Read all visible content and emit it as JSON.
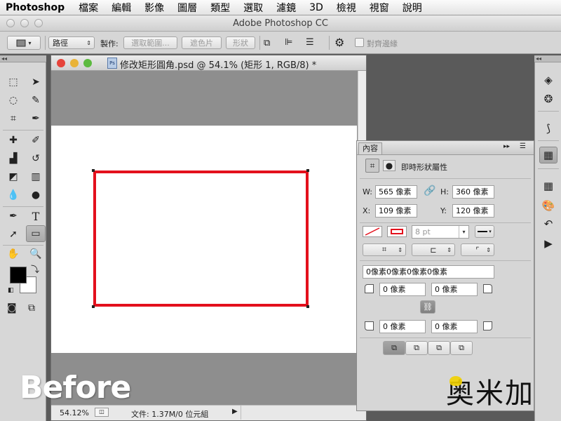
{
  "menubar": {
    "app_name": "Photoshop",
    "items": [
      "檔案",
      "編輯",
      "影像",
      "圖層",
      "類型",
      "選取",
      "濾鏡",
      "3D",
      "檢視",
      "視窗",
      "說明"
    ]
  },
  "window": {
    "title": "Adobe Photoshop CC"
  },
  "options_bar": {
    "mode_value": "路徑",
    "make_label": "製作:",
    "selection_button": "選取範圍...",
    "mask_button": "遮色片",
    "shape_button": "形狀",
    "align_edges_label": "對齊邊緣"
  },
  "document": {
    "title": "修改矩形圓角.psd @ 54.1% (矩形 1, RGB/8) *",
    "zoom": "54.12%",
    "file_info": "文件: 1.37M/0 位元組"
  },
  "properties_panel": {
    "tab_label": "內容",
    "shape_title": "即時形狀屬性",
    "w_label": "W:",
    "w_value": "565 像素",
    "h_label": "H:",
    "h_value": "360 像素",
    "x_label": "X:",
    "x_value": "109 像素",
    "y_label": "Y:",
    "y_value": "120 像素",
    "stroke_width": "8 pt",
    "corner_summary": "0像素0像素0像素0像素",
    "corner_top_left": "0 像素",
    "corner_top_right": "0 像素",
    "corner_bottom_left": "0 像素",
    "corner_bottom_right": "0 像素"
  },
  "overlay": {
    "before_label": "Before",
    "logo_text": "奥米加"
  },
  "colors": {
    "rectangle_stroke": "#e3101c",
    "foreground": "#000000",
    "background": "#ffffff"
  },
  "icons": {
    "toolbox": [
      "marquee-icon",
      "move-icon",
      "lasso-icon",
      "quick-select-icon",
      "crop-icon",
      "eyedropper-icon",
      "healing-icon",
      "brush-icon",
      "stamp-icon",
      "history-brush-icon",
      "eraser-icon",
      "gradient-icon",
      "blur-icon",
      "dodge-icon",
      "pen-icon",
      "type-icon",
      "path-select-icon",
      "rectangle-icon",
      "hand-icon",
      "zoom-icon"
    ],
    "right_dock": [
      "layers-icon",
      "channels-icon",
      "paths-icon",
      "properties-icon",
      "swatches-icon",
      "styles-icon",
      "history-icon",
      "actions-icon"
    ]
  }
}
